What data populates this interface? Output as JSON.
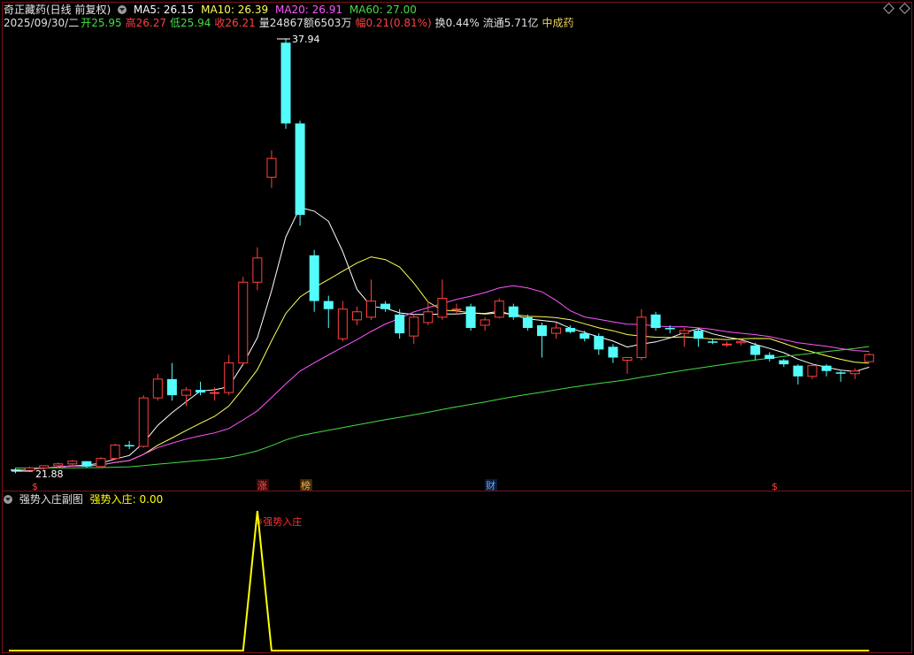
{
  "header": {
    "title": "奇正藏药(日线 前复权)",
    "ma": [
      {
        "label": "MA5: 26.15",
        "color": "#ffffff"
      },
      {
        "label": "MA10: 26.39",
        "color": "#ffff55"
      },
      {
        "label": "MA20: 26.91",
        "color": "#ff55ff"
      },
      {
        "label": "MA60: 27.00",
        "color": "#44dd44"
      }
    ],
    "date": "2025/09/30/二",
    "open_label": "开",
    "open_value": "25.95",
    "high_label": "高",
    "high_value": "26.27",
    "low_label": "低",
    "low_value": "25.94",
    "close_label": "收",
    "close_value": "26.21",
    "volume": "量24867",
    "amount": "额6503万",
    "change_label": "幅",
    "change_value": "0.21(0.81%)",
    "turnover": "换0.44%",
    "float_cap": "流通5.71亿",
    "sector": "中成药"
  },
  "colors": {
    "up": "#ff4040",
    "down": "#54fcfc",
    "ma5": "#ffffff",
    "ma10": "#ffff55",
    "ma20": "#ff55ff",
    "ma60": "#44dd44",
    "indicator": "#ffff00"
  },
  "markers": {
    "dollar": "$",
    "zhang": "涨",
    "bang": "榜",
    "cai": "财"
  },
  "sub_panel": {
    "title": "强势入庄副图",
    "indicator_label": "强势入庄: 0.00",
    "signal_label": "※强势入庄"
  },
  "chart_data": [
    {
      "type": "candlestick",
      "title": "奇正藏药(日线 前复权)",
      "annotations": {
        "max_price": "37.94",
        "min_price": "21.88"
      },
      "candles": [
        [
          21.95,
          22.0,
          21.8,
          21.9
        ],
        [
          21.9,
          22.05,
          21.85,
          22.0
        ],
        [
          22.0,
          22.1,
          21.9,
          22.08
        ],
        [
          22.08,
          22.2,
          22.0,
          22.15
        ],
        [
          22.15,
          22.3,
          22.05,
          22.25
        ],
        [
          22.25,
          22.25,
          22.0,
          22.05
        ],
        [
          22.05,
          22.4,
          22.0,
          22.35
        ],
        [
          22.35,
          22.9,
          22.3,
          22.85
        ],
        [
          22.85,
          23.0,
          22.7,
          22.8
        ],
        [
          22.8,
          24.7,
          22.75,
          24.6
        ],
        [
          24.6,
          25.5,
          24.5,
          25.3
        ],
        [
          25.3,
          25.9,
          24.5,
          24.7
        ],
        [
          24.7,
          25.0,
          24.3,
          24.9
        ],
        [
          24.9,
          25.2,
          24.7,
          24.8
        ],
        [
          24.8,
          25.0,
          24.5,
          24.8
        ],
        [
          24.8,
          26.2,
          24.7,
          25.9
        ],
        [
          25.9,
          29.1,
          25.8,
          28.9
        ],
        [
          28.9,
          30.2,
          28.6,
          29.8
        ],
        [
          32.8,
          33.8,
          32.4,
          33.5
        ],
        [
          37.8,
          37.94,
          34.6,
          34.8
        ],
        [
          34.8,
          34.9,
          31.0,
          31.4
        ],
        [
          29.9,
          30.1,
          27.8,
          28.2
        ],
        [
          28.2,
          28.4,
          27.2,
          27.9
        ],
        [
          26.8,
          28.2,
          26.7,
          27.9
        ],
        [
          27.5,
          28.0,
          27.3,
          27.8
        ],
        [
          27.6,
          29.0,
          27.5,
          28.2
        ],
        [
          28.1,
          28.2,
          27.8,
          27.9
        ],
        [
          27.7,
          27.9,
          26.8,
          27.0
        ],
        [
          26.9,
          27.7,
          26.6,
          27.6
        ],
        [
          27.4,
          28.2,
          27.3,
          27.8
        ],
        [
          27.6,
          29.0,
          27.5,
          28.3
        ],
        [
          27.9,
          28.1,
          27.7,
          27.9
        ],
        [
          28.0,
          28.1,
          27.1,
          27.2
        ],
        [
          27.3,
          27.6,
          27.1,
          27.5
        ],
        [
          27.6,
          28.3,
          27.55,
          28.2
        ],
        [
          28.0,
          28.1,
          27.5,
          27.6
        ],
        [
          27.6,
          27.7,
          27.1,
          27.2
        ],
        [
          27.3,
          27.4,
          26.1,
          26.9
        ],
        [
          27.0,
          27.4,
          26.8,
          27.2
        ],
        [
          27.2,
          27.3,
          27.0,
          27.05
        ],
        [
          27.0,
          27.1,
          26.7,
          26.8
        ],
        [
          26.9,
          27.0,
          26.2,
          26.4
        ],
        [
          26.5,
          26.6,
          25.9,
          26.1
        ],
        [
          26.0,
          26.1,
          25.5,
          26.1
        ],
        [
          26.1,
          27.9,
          26.0,
          27.6
        ],
        [
          27.7,
          27.8,
          27.1,
          27.2
        ],
        [
          27.2,
          27.3,
          27.0,
          27.15
        ],
        [
          27.0,
          27.2,
          26.5,
          27.1
        ],
        [
          27.1,
          27.15,
          26.5,
          26.8
        ],
        [
          26.7,
          26.8,
          26.6,
          26.65
        ],
        [
          26.6,
          26.7,
          26.5,
          26.6
        ],
        [
          26.65,
          26.8,
          26.55,
          26.7
        ],
        [
          26.55,
          26.65,
          26.0,
          26.2
        ],
        [
          26.2,
          26.3,
          25.95,
          26.05
        ],
        [
          26.0,
          26.05,
          25.75,
          25.85
        ],
        [
          25.8,
          25.85,
          25.1,
          25.4
        ],
        [
          25.4,
          25.85,
          25.3,
          25.8
        ],
        [
          25.8,
          25.85,
          25.4,
          25.6
        ],
        [
          25.55,
          25.6,
          25.2,
          25.5
        ],
        [
          25.5,
          25.7,
          25.3,
          25.6
        ],
        [
          25.95,
          26.27,
          25.94,
          26.21
        ]
      ],
      "ma5_last": 26.15,
      "ma10_last": 26.39,
      "ma20_last": 26.91,
      "ma60_last": 27.0
    },
    {
      "type": "line",
      "title": "强势入庄副图",
      "series": [
        {
          "name": "强势入庄",
          "values": [
            0,
            0,
            0,
            0,
            0,
            0,
            0,
            0,
            0,
            0,
            0,
            0,
            0,
            0,
            0,
            0,
            0,
            1,
            0,
            0,
            0,
            0,
            0,
            0,
            0,
            0,
            0,
            0,
            0,
            0,
            0,
            0,
            0,
            0,
            0,
            0,
            0,
            0,
            0,
            0,
            0,
            0,
            0,
            0,
            0,
            0,
            0,
            0,
            0,
            0,
            0,
            0,
            0,
            0,
            0,
            0,
            0,
            0,
            0,
            0,
            0
          ]
        }
      ]
    }
  ]
}
